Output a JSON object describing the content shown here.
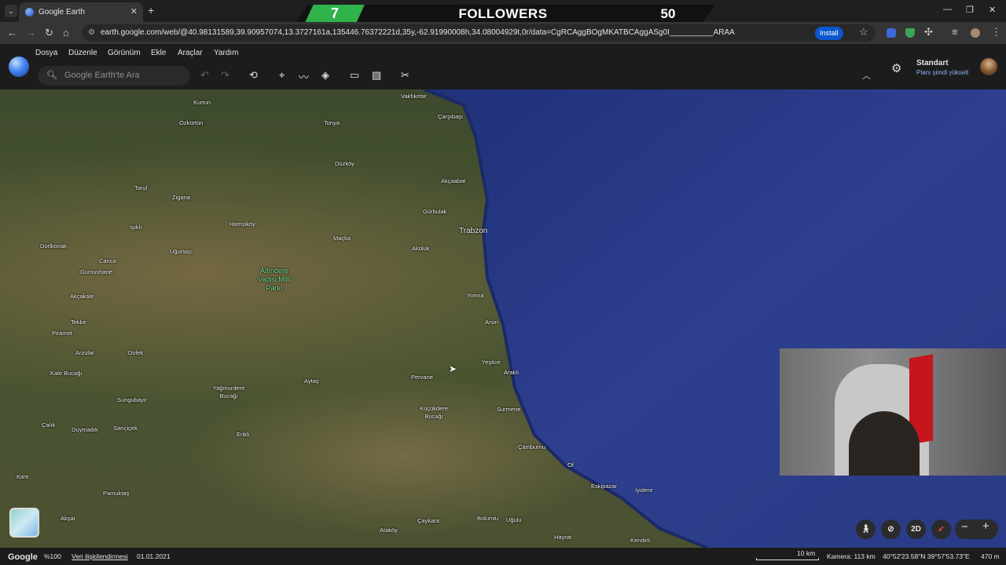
{
  "browser": {
    "tab_title": "Google Earth",
    "url": "earth.google.com/web/@40.98131589,39.90957074,13.3727161a,135446.76372221d,35y,-62.91990008h,34.08004929t,0r/data=CgRCAggBOgMKATBCAggASg0I__________ARAA",
    "install_label": "Install",
    "tab_menu_icon": "chevron-down-icon",
    "new_tab_icon": "plus-icon"
  },
  "overlay": {
    "follower_count": "7",
    "title": "FOLLOWERS",
    "goal": "50",
    "accent_color": "#2fb34a"
  },
  "app": {
    "menus": [
      "Dosya",
      "Düzenle",
      "Görünüm",
      "Ekle",
      "Araçlar",
      "Yardım"
    ],
    "search_placeholder": "Google Earth'te Ara",
    "plan_name": "Standart",
    "plan_upgrade": "Planı şimdi yükselt"
  },
  "map": {
    "places": [
      {
        "name": "Vakfıkebir"
      },
      {
        "name": "Kurtun"
      },
      {
        "name": "Çarşıbaşı"
      },
      {
        "name": "Özkürtün"
      },
      {
        "name": "Tonya"
      },
      {
        "name": "Düzköy"
      },
      {
        "name": "Akçaabat"
      },
      {
        "name": "Torul"
      },
      {
        "name": "Zigana"
      },
      {
        "name": "Gürbulak"
      },
      {
        "name": "Trabzon"
      },
      {
        "name": "Hamsiköy"
      },
      {
        "name": "Işıklı"
      },
      {
        "name": "Maçka"
      },
      {
        "name": "Dorlkonak"
      },
      {
        "name": "Uğurlaşı"
      },
      {
        "name": "Akoluk"
      },
      {
        "name": "Canca"
      },
      {
        "name": "Gumushane"
      },
      {
        "name": "Altındere Vadisi Milli Parkı"
      },
      {
        "name": "Akçakale"
      },
      {
        "name": "Yomra"
      },
      {
        "name": "Tekke"
      },
      {
        "name": "Arsin"
      },
      {
        "name": "Piramet"
      },
      {
        "name": "Arzular"
      },
      {
        "name": "Dolek"
      },
      {
        "name": "Yeşilce"
      },
      {
        "name": "Kale Bucağı"
      },
      {
        "name": "Araklı"
      },
      {
        "name": "Pervane"
      },
      {
        "name": "Aytaş"
      },
      {
        "name": "Yağmurdere Bucağı"
      },
      {
        "name": "Sungubayir"
      },
      {
        "name": "Küçükdere Bucağı"
      },
      {
        "name": "Surmene"
      },
      {
        "name": "Çalık"
      },
      {
        "name": "Duymadık"
      },
      {
        "name": "Sarıçiçek"
      },
      {
        "name": "Erikli"
      },
      {
        "name": "Çamburnu"
      },
      {
        "name": "Kitre"
      },
      {
        "name": "Of"
      },
      {
        "name": "Pamuktaş"
      },
      {
        "name": "Eskipazar"
      },
      {
        "name": "İyidere"
      },
      {
        "name": "Akşar"
      },
      {
        "name": "Çaykara"
      },
      {
        "name": "Bolumlu"
      },
      {
        "name": "Uğulu"
      },
      {
        "name": "Ataköy"
      },
      {
        "name": "Hayrat"
      },
      {
        "name": "Kendirli"
      }
    ]
  },
  "controls": {
    "view_2d_label": "2D"
  },
  "status": {
    "brand": "Google",
    "zoom": "%100",
    "data_attribution": "Veri ilişkilendirmesi",
    "date": "01.01.2021",
    "scale": "10 km",
    "camera": "Kamera: 113 km",
    "coordinates": "40°52'23.58\"N 39°57'53.73\"E",
    "elevation": "470 m"
  }
}
